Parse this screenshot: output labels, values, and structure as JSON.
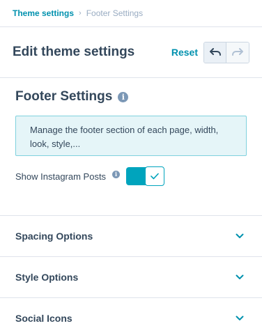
{
  "breadcrumb": {
    "parent": "Theme settings",
    "separator": "›",
    "current": "Footer Settings"
  },
  "header": {
    "title": "Edit theme settings",
    "reset_label": "Reset",
    "undo_icon": "undo-icon",
    "redo_icon": "redo-icon"
  },
  "panel": {
    "title": "Footer Settings",
    "info_icon": "info-icon",
    "description": "Manage the footer section of each page, width, look, style,...",
    "toggle": {
      "label": "Show Instagram Posts",
      "state": "on",
      "icon": "check-icon"
    }
  },
  "sections": [
    {
      "label": "Spacing Options",
      "icon": "chevron-down-icon"
    },
    {
      "label": "Style Options",
      "icon": "chevron-down-icon"
    },
    {
      "label": "Social Icons",
      "icon": "chevron-down-icon"
    }
  ],
  "colors": {
    "accent": "#0091ae",
    "toggle": "#00a4bd",
    "text": "#33475b",
    "description_bg": "#e5f5f8",
    "description_border": "#7fd1de"
  }
}
